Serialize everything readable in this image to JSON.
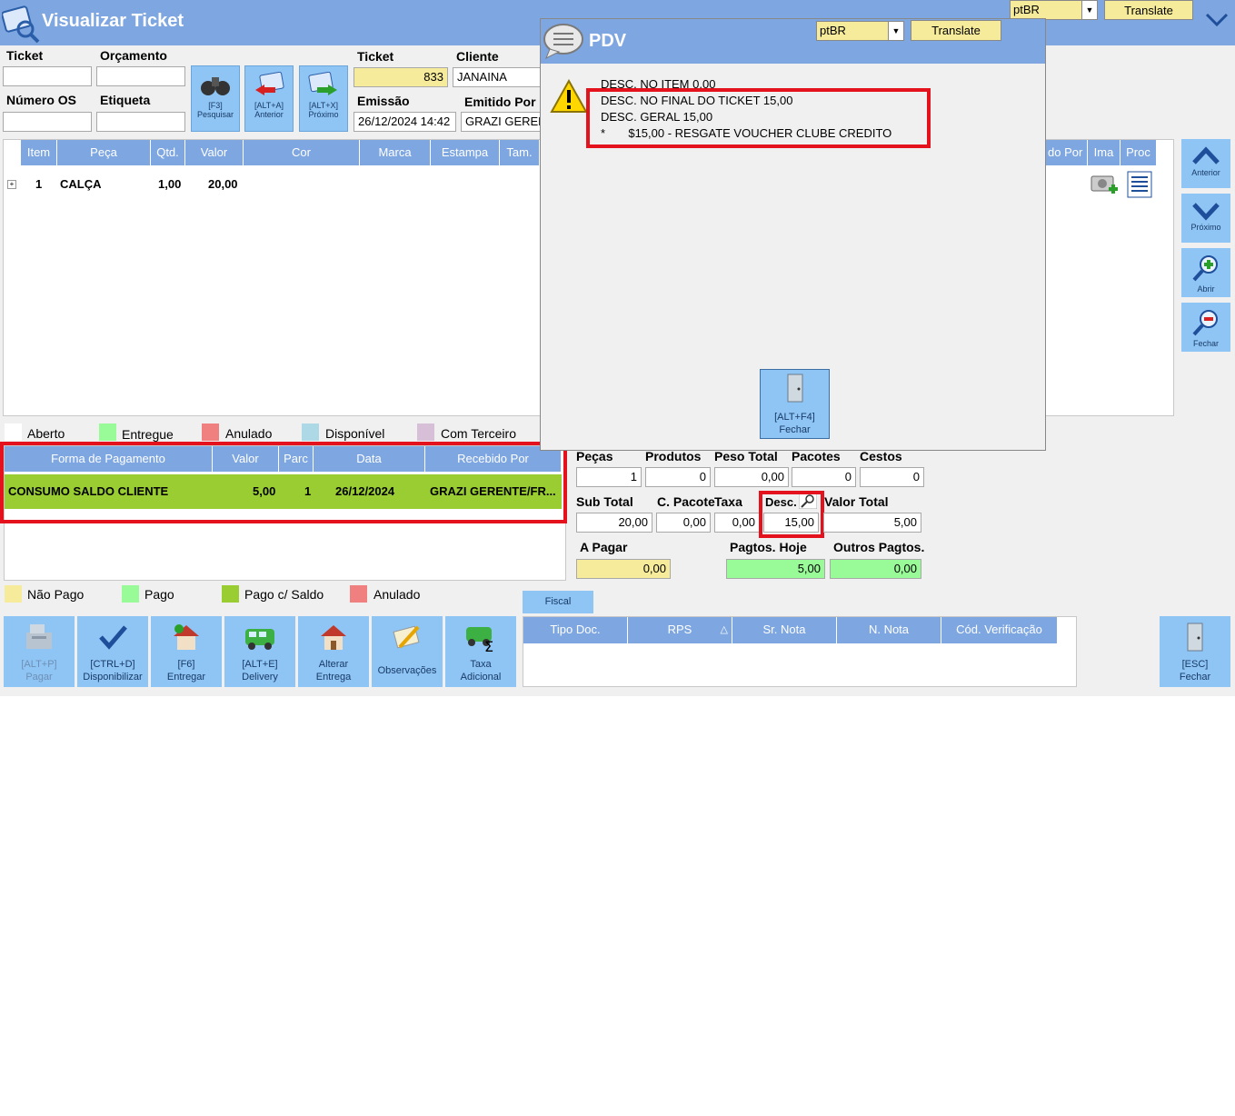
{
  "window": {
    "title": "Visualizar Ticket"
  },
  "top_right": {
    "lang": "ptBR",
    "translate": "Translate"
  },
  "form": {
    "ticket_label": "Ticket",
    "orcamento_label": "Orçamento",
    "numero_os_label": "Número OS",
    "etiqueta_label": "Etiqueta",
    "ticket_num_label": "Ticket",
    "ticket_value": "833",
    "cliente_label": "Cliente",
    "cliente_value": "JANAINA",
    "emissao_label": "Emissão",
    "emissao_value": "26/12/2024 14:42",
    "emitido_por_label": "Emitido Por",
    "emitido_por_value": "GRAZI GEREN"
  },
  "toolbar": {
    "pesquisar": {
      "key": "[F3]",
      "label": "Pesquisar"
    },
    "anterior": {
      "key": "[ALT+A]",
      "label": "Anterior"
    },
    "proximo": {
      "key": "[ALT+X]",
      "label": "Próximo"
    }
  },
  "items_table": {
    "headers": [
      "Item",
      "Peça",
      "Qtd.",
      "Valor",
      "Cor",
      "Marca",
      "Estampa",
      "Tam."
    ],
    "right_headers": [
      "do Por",
      "Ima",
      "Proc"
    ],
    "rows": [
      {
        "item": "1",
        "peca": "CALÇA",
        "qtd": "1,00",
        "valor": "20,00"
      }
    ]
  },
  "side_nav": {
    "anterior": "Anterior",
    "proximo": "Próximo",
    "abrir": "Abrir",
    "fechar": "Fechar"
  },
  "status_legend": {
    "aberto": "Aberto",
    "entregue": "Entregue",
    "anulado": "Anulado",
    "disponivel": "Disponível",
    "com_terceiro": "Com Terceiro"
  },
  "payments": {
    "headers": [
      "Forma de Pagamento",
      "Valor",
      "Parc",
      "Data",
      "Recebido Por"
    ],
    "rows": [
      {
        "forma": "CONSUMO SALDO CLIENTE",
        "valor": "5,00",
        "parc": "1",
        "data": "26/12/2024",
        "recebido": "GRAZI  GERENTE/FR..."
      }
    ]
  },
  "payment_legend": {
    "nao_pago": "Não Pago",
    "pago": "Pago",
    "pago_saldo": "Pago c/ Saldo",
    "anulado": "Anulado"
  },
  "totals": {
    "pecas_label": "Peças",
    "pecas": "1",
    "produtos_label": "Produtos",
    "produtos": "0",
    "peso_label": "Peso Total",
    "peso": "0,00",
    "pacotes_label": "Pacotes",
    "pacotes": "0",
    "cestos_label": "Cestos",
    "cestos": "0",
    "subtotal_label": "Sub Total",
    "subtotal": "20,00",
    "cpacote_label": "C. Pacote",
    "cpacote": "0,00",
    "taxa_label": "Taxa",
    "taxa": "0,00",
    "desc_label": "Desc.",
    "desc": "15,00",
    "valortotal_label": "Valor Total",
    "valortotal": "5,00",
    "apagar_label": "A Pagar",
    "apagar": "0,00",
    "pagtos_hoje_label": "Pagtos. Hoje",
    "pagtos_hoje": "5,00",
    "outros_label": "Outros Pagtos.",
    "outros": "0,00"
  },
  "fiscal": {
    "tab": "Fiscal",
    "headers": [
      "Tipo Doc.",
      "RPS",
      "Sr. Nota",
      "N. Nota",
      "Cód. Verificação"
    ]
  },
  "bottom_buttons": {
    "pagar": {
      "key": "[ALT+P]",
      "label": "Pagar"
    },
    "disponibilizar": {
      "key": "[CTRL+D]",
      "label": "Disponibilizar"
    },
    "entregar": {
      "key": "[F6]",
      "label": "Entregar"
    },
    "delivery": {
      "key": "[ALT+E]",
      "label": "Delivery"
    },
    "alterar": {
      "key": "Alterar",
      "label": "Entrega"
    },
    "observacoes": {
      "label": "Observações"
    },
    "taxa": {
      "key": "Taxa",
      "label": "Adicional"
    },
    "fechar": {
      "key": "[ESC]",
      "label": "Fechar"
    }
  },
  "dialog": {
    "title": "PDV",
    "lang": "ptBR",
    "translate": "Translate",
    "lines": [
      "DESC. NO ITEM 0,00",
      "DESC. NO FINAL DO TICKET 15,00",
      "DESC. GERAL 15,00",
      "*       $15,00 - RESGATE VOUCHER CLUBE CREDITO"
    ],
    "close": {
      "key": "[ALT+F4]",
      "label": "Fechar"
    }
  }
}
